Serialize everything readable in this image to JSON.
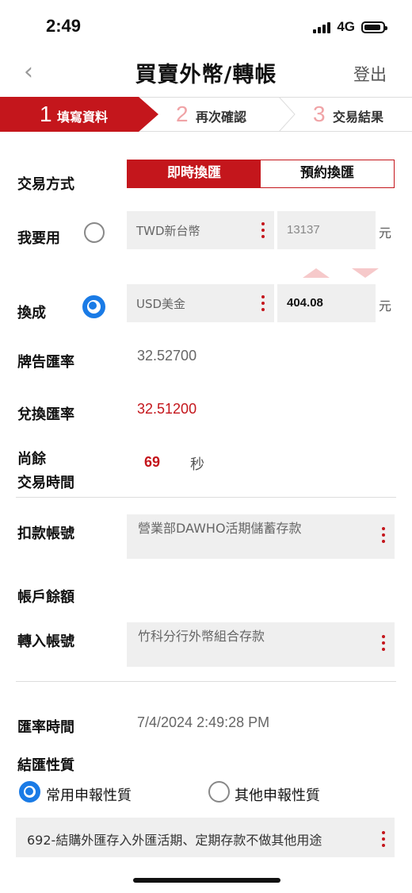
{
  "status_bar": {
    "time": "2:49",
    "network": "4G"
  },
  "header": {
    "title": "買賣外幣/轉帳",
    "back_icon": "‹",
    "logout": "登出"
  },
  "steps": [
    {
      "num": "1",
      "label": "填寫資料",
      "active": true
    },
    {
      "num": "2",
      "label": "再次確認",
      "active": false
    },
    {
      "num": "3",
      "label": "交易結果",
      "active": false
    }
  ],
  "trade": {
    "method_label": "交易方式",
    "options": [
      "即時換匯",
      "預約換匯"
    ],
    "use_label": "我要用",
    "use_currency": "TWD新台幣",
    "use_amount": "13137",
    "use_unit": "元",
    "to_label": "換成",
    "to_currency": "USD美金",
    "to_amount": "404.08",
    "to_unit": "元"
  },
  "rates": {
    "board_label": "牌告匯率",
    "board_value": "32.52700",
    "exchange_label": "兌換匯率",
    "exchange_value": "32.51200",
    "remaining_label_1": "尚餘",
    "remaining_label_2": "交易時間",
    "remaining_value": "69",
    "remaining_unit": "秒"
  },
  "accounts": {
    "debit_label": "扣款帳號",
    "debit_value": "營業部DAWHO活期儲蓄存款",
    "balance_label": "帳戶餘額",
    "credit_label": "轉入帳號",
    "credit_value": "竹科分行外幣組合存款"
  },
  "settlement": {
    "rate_time_label": "匯率時間",
    "rate_time_value": "7/4/2024 2:49:28 PM",
    "nature_label": "結匯性質",
    "nature_options": [
      "常用申報性質",
      "其他申報性質"
    ],
    "nature_selected": "692-結購外匯存入外匯活期、定期存款不做其他用途"
  },
  "colors": {
    "accent": "#c4161c",
    "radio": "#1a7be6"
  }
}
